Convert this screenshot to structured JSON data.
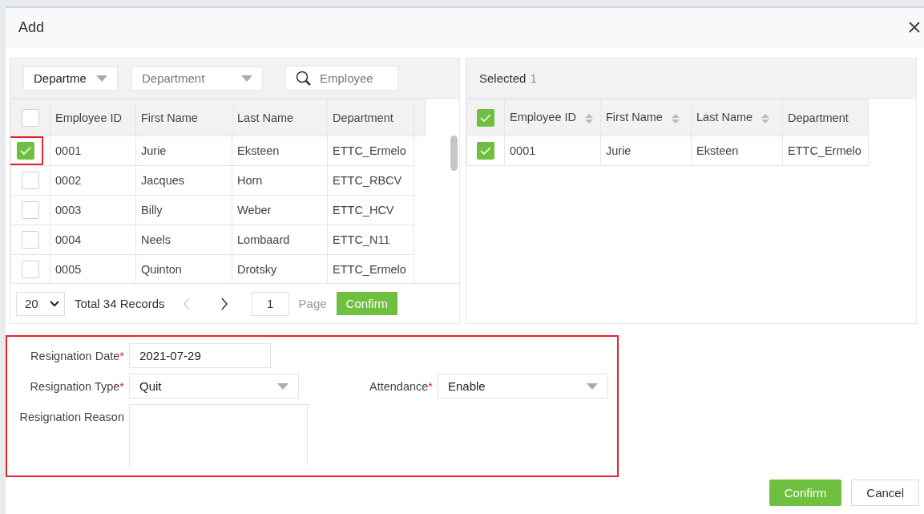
{
  "dialog": {
    "title": "Add"
  },
  "filters": [
    {
      "kind": "select",
      "value": "Departme"
    },
    {
      "kind": "select",
      "placeholder": "Department"
    },
    {
      "kind": "search",
      "placeholder": "Employee"
    }
  ],
  "employee_table": {
    "header_checked": false,
    "columns": [
      "Employee ID",
      "First Name",
      "Last Name",
      "Department"
    ],
    "rows": [
      {
        "selected": true,
        "cells": [
          "0001",
          "Jurie",
          "Eksteen",
          "ETTC_Ermelo"
        ]
      },
      {
        "selected": false,
        "cells": [
          "0002",
          "Jacques",
          "Horn",
          "ETTC_RBCV"
        ]
      },
      {
        "selected": false,
        "cells": [
          "0003",
          "Billy",
          "Weber",
          "ETTC_HCV"
        ]
      },
      {
        "selected": false,
        "cells": [
          "0004",
          "Neels",
          "Lombaard",
          "ETTC_N11"
        ]
      },
      {
        "selected": false,
        "cells": [
          "0005",
          "Quinton",
          "Drotsky",
          "ETTC_Ermelo"
        ]
      }
    ]
  },
  "pager": {
    "page_size": "20",
    "total": "Total 34 Records",
    "page": "1",
    "page_label": "Page",
    "button": "Confirm"
  },
  "selected_panel": {
    "label": "Selected",
    "count": "1",
    "header_checked": true,
    "columns": [
      {
        "label": "Employee ID",
        "sortable": true
      },
      {
        "label": "First Name",
        "sortable": true
      },
      {
        "label": "Last Name",
        "sortable": true
      },
      {
        "label": "Department",
        "sortable": false
      }
    ],
    "rows": [
      {
        "selected": true,
        "cells": [
          "0001",
          "Jurie",
          "Eksteen",
          "ETTC_Ermelo"
        ]
      }
    ]
  },
  "form": [
    {
      "kind": "date",
      "label": "Resignation Date",
      "required": true,
      "value": "2021-07-29"
    },
    {
      "kind": "select",
      "label": "Resignation Type",
      "required": true,
      "value": "Quit"
    },
    {
      "kind": "select",
      "label": "Attendance",
      "required": true,
      "value": "Enable"
    },
    {
      "kind": "textarea",
      "label": "Resignation Reason",
      "required": false
    }
  ],
  "required_mark": "*",
  "buttons": [
    {
      "kind": "primary",
      "label": "Confirm"
    },
    {
      "kind": "default",
      "label": "Cancel"
    }
  ]
}
